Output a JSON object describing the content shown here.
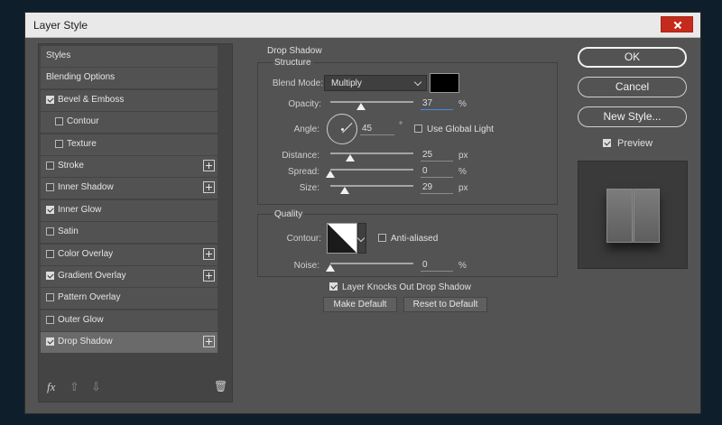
{
  "window": {
    "title": "Layer Style"
  },
  "styles_list": [
    {
      "label": "Styles",
      "checkbox": false,
      "checked": false,
      "indent": false,
      "plus": false,
      "selected": false
    },
    {
      "label": "Blending Options",
      "checkbox": false,
      "checked": false,
      "indent": false,
      "plus": false,
      "selected": false
    },
    {
      "label": "Bevel & Emboss",
      "checkbox": true,
      "checked": true,
      "indent": false,
      "plus": false,
      "selected": false
    },
    {
      "label": "Contour",
      "checkbox": true,
      "checked": false,
      "indent": true,
      "plus": false,
      "selected": false
    },
    {
      "label": "Texture",
      "checkbox": true,
      "checked": false,
      "indent": true,
      "plus": false,
      "selected": false
    },
    {
      "label": "Stroke",
      "checkbox": true,
      "checked": false,
      "indent": false,
      "plus": true,
      "selected": false
    },
    {
      "label": "Inner Shadow",
      "checkbox": true,
      "checked": false,
      "indent": false,
      "plus": true,
      "selected": false
    },
    {
      "label": "Inner Glow",
      "checkbox": true,
      "checked": true,
      "indent": false,
      "plus": false,
      "selected": false
    },
    {
      "label": "Satin",
      "checkbox": true,
      "checked": false,
      "indent": false,
      "plus": false,
      "selected": false
    },
    {
      "label": "Color Overlay",
      "checkbox": true,
      "checked": false,
      "indent": false,
      "plus": true,
      "selected": false
    },
    {
      "label": "Gradient Overlay",
      "checkbox": true,
      "checked": true,
      "indent": false,
      "plus": true,
      "selected": false
    },
    {
      "label": "Pattern Overlay",
      "checkbox": true,
      "checked": false,
      "indent": false,
      "plus": false,
      "selected": false
    },
    {
      "label": "Outer Glow",
      "checkbox": true,
      "checked": false,
      "indent": false,
      "plus": false,
      "selected": false
    },
    {
      "label": "Drop Shadow",
      "checkbox": true,
      "checked": true,
      "indent": false,
      "plus": true,
      "selected": true
    }
  ],
  "bottom_tools": {
    "fx": "fx",
    "up": "⇧",
    "down": "⇩",
    "trash": "🗑"
  },
  "drop_shadow": {
    "section_title": "Drop Shadow",
    "structure_title": "Structure",
    "blend_mode_label": "Blend Mode:",
    "blend_mode_value": "Multiply",
    "shadow_color": "#000000",
    "opacity_label": "Opacity:",
    "opacity_value": "37",
    "opacity_level": 0.37,
    "angle_label": "Angle:",
    "angle_value": "45",
    "angle_unit": "°",
    "use_global_light_label": "Use Global Light",
    "use_global_light_checked": false,
    "distance_label": "Distance:",
    "distance_value": "25",
    "spread_label": "Spread:",
    "spread_value": "0",
    "size_label": "Size:",
    "size_value": "29",
    "percent_unit": "%",
    "px_unit": "px",
    "quality_title": "Quality",
    "contour_label": "Contour:",
    "anti_aliased_label": "Anti-aliased",
    "anti_aliased_checked": false,
    "noise_label": "Noise:",
    "noise_value": "0",
    "knockout_label": "Layer Knocks Out Drop Shadow",
    "knockout_checked": true,
    "make_default_label": "Make Default",
    "reset_default_label": "Reset to Default"
  },
  "right_panel": {
    "ok_label": "OK",
    "cancel_label": "Cancel",
    "new_style_label": "New Style...",
    "preview_label": "Preview",
    "preview_checked": true
  }
}
